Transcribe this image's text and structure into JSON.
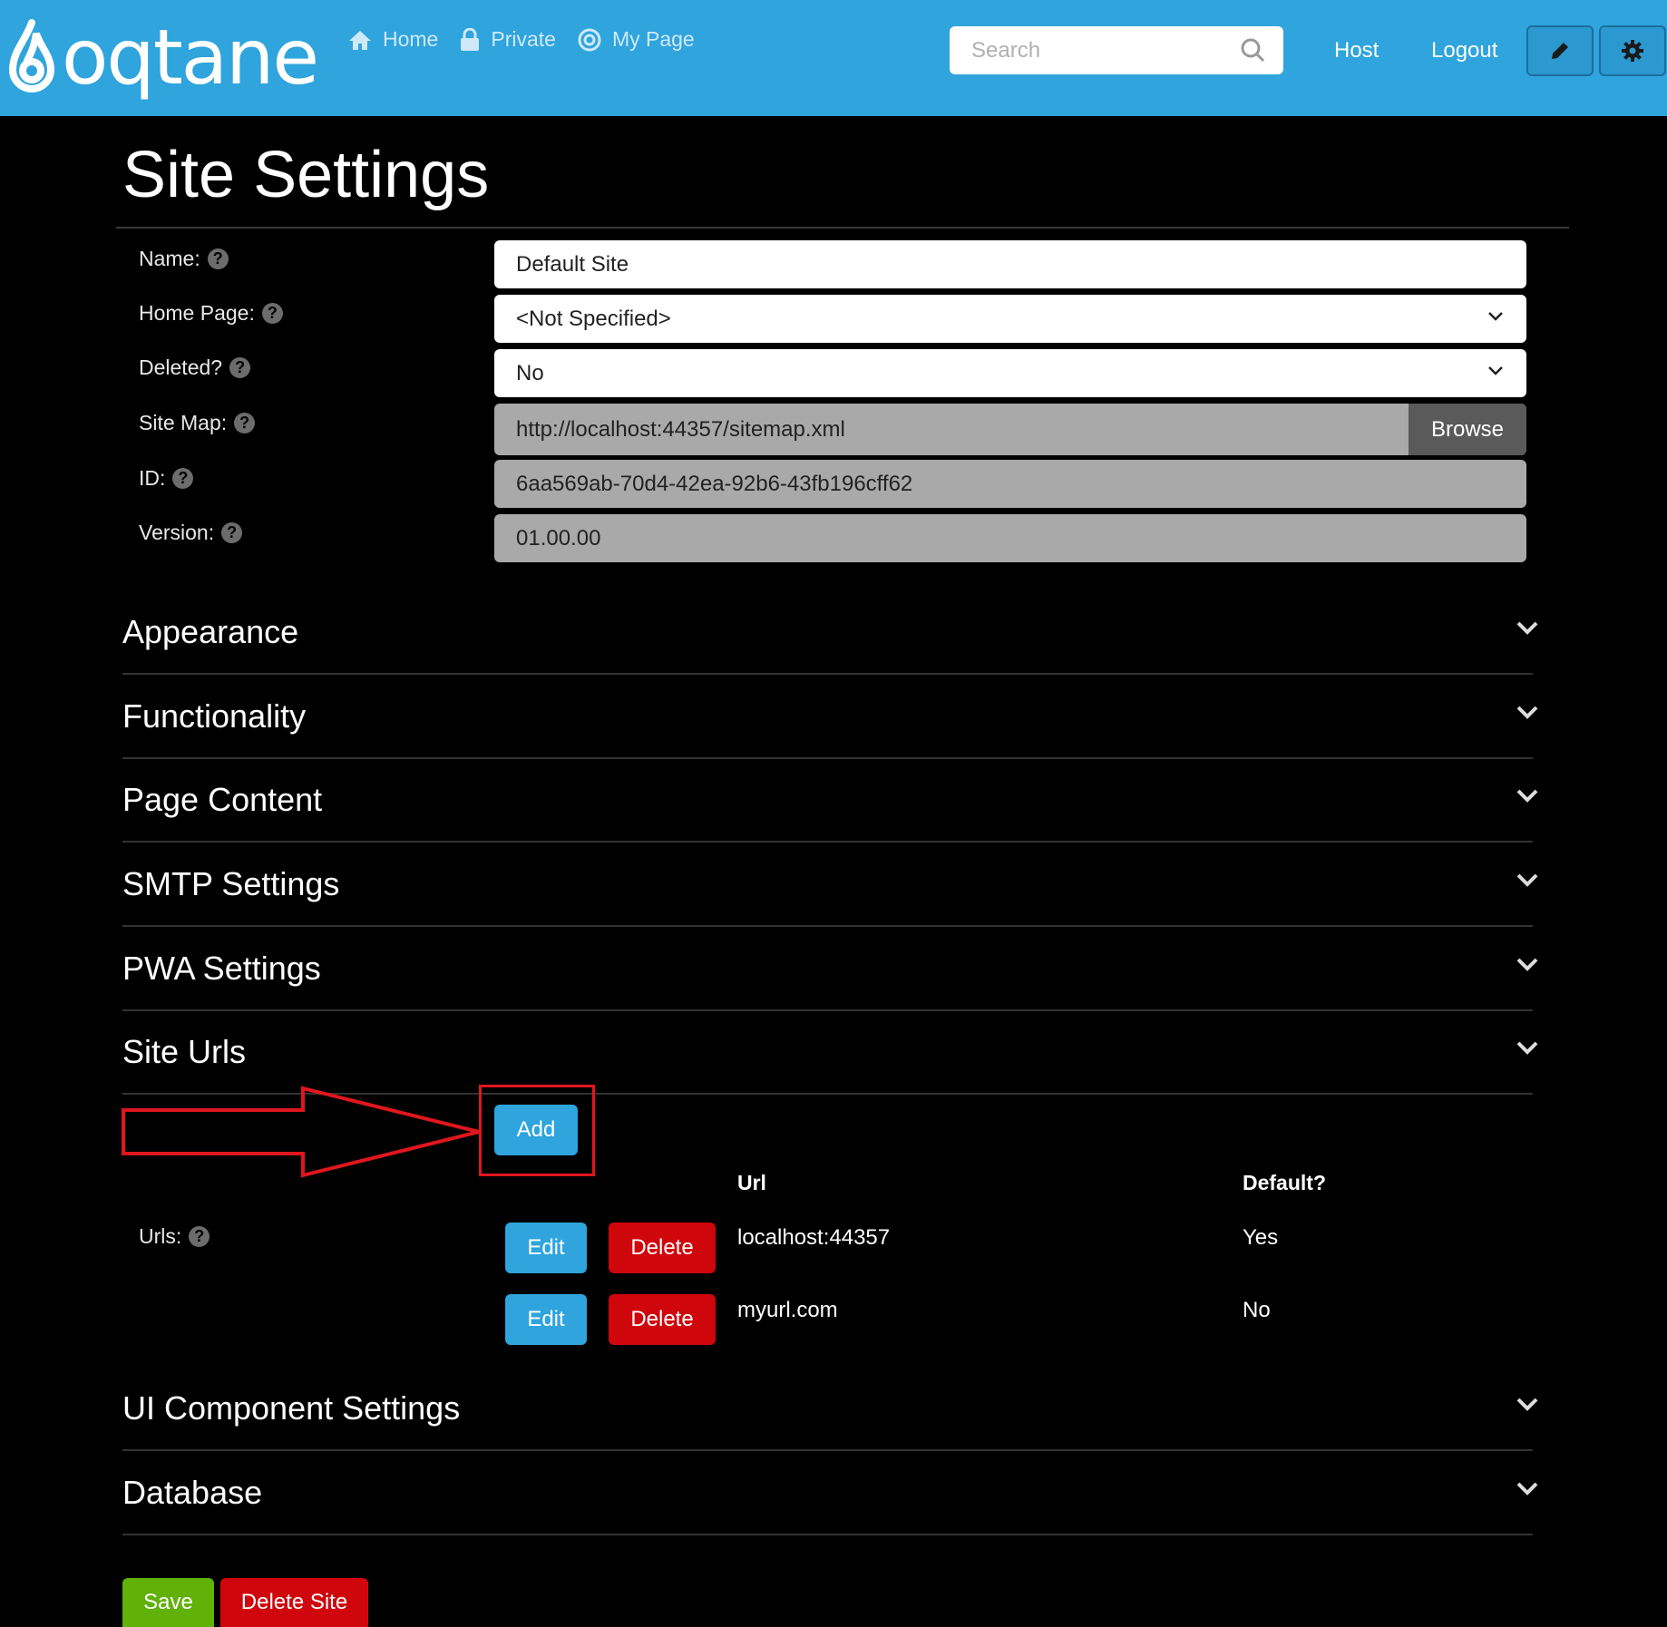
{
  "header": {
    "logo_text": "oqtane",
    "nav": [
      {
        "label": "Home",
        "icon": "home-icon"
      },
      {
        "label": "Private",
        "icon": "lock-icon"
      },
      {
        "label": "My Page",
        "icon": "target-icon"
      }
    ],
    "search_placeholder": "Search",
    "host_label": "Host",
    "logout_label": "Logout",
    "edit_icon": "pencil-icon",
    "settings_icon": "gear-icon"
  },
  "page": {
    "title": "Site Settings"
  },
  "form": {
    "name_label": "Name:",
    "name_value": "Default Site",
    "home_page_label": "Home Page:",
    "home_page_value": "<Not Specified>",
    "deleted_label": "Deleted?",
    "deleted_value": "No",
    "sitemap_label": "Site Map:",
    "sitemap_value": "http://localhost:44357/sitemap.xml",
    "browse_label": "Browse",
    "id_label": "ID:",
    "id_value": "6aa569ab-70d4-42ea-92b6-43fb196cff62",
    "version_label": "Version:",
    "version_value": "01.00.00",
    "help_glyph": "?"
  },
  "sections": {
    "appearance": "Appearance",
    "functionality": "Functionality",
    "page_content": "Page Content",
    "smtp": "SMTP Settings",
    "pwa": "PWA Settings",
    "site_urls": "Site Urls",
    "ui_component": "UI Component Settings",
    "database": "Database"
  },
  "site_urls": {
    "add_label": "Add",
    "urls_label": "Urls:",
    "col_url": "Url",
    "col_default": "Default?",
    "rows": [
      {
        "edit": "Edit",
        "delete": "Delete",
        "url": "localhost:44357",
        "default": "Yes"
      },
      {
        "edit": "Edit",
        "delete": "Delete",
        "url": "myurl.com",
        "default": "No"
      }
    ]
  },
  "footer": {
    "save_label": "Save",
    "delete_site_label": "Delete Site"
  },
  "colors": {
    "header_bg": "#2fa4dd",
    "primary": "#2fa4dd",
    "danger": "#d0060d",
    "success": "#61b108",
    "annotation": "#e0161e"
  }
}
